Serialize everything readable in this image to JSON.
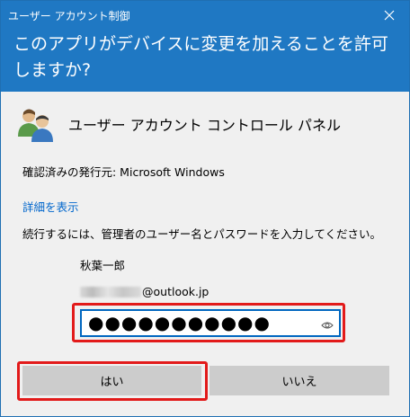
{
  "window": {
    "title": "ユーザー アカウント制御"
  },
  "header": {
    "question": "このアプリがデバイスに変更を加えることを許可しますか?"
  },
  "app": {
    "name": "ユーザー アカウント コントロール パネル",
    "icon": "users-icon"
  },
  "publisher": {
    "text": "確認済みの発行元: Microsoft Windows"
  },
  "details": {
    "link_label": "詳細を表示"
  },
  "instruction": {
    "text": "続行するには、管理者のユーザー名とパスワードを入力してください。"
  },
  "account": {
    "display_name": "秋葉一郎",
    "email_domain": "@outlook.jp"
  },
  "password": {
    "masked_value": "●●●●●●●●●●●"
  },
  "buttons": {
    "yes_label": "はい",
    "no_label": "いいえ"
  },
  "colors": {
    "header_bg": "#1f78c3",
    "highlight": "#e21a1a",
    "focus": "#0067c0",
    "link": "#0066cc"
  }
}
